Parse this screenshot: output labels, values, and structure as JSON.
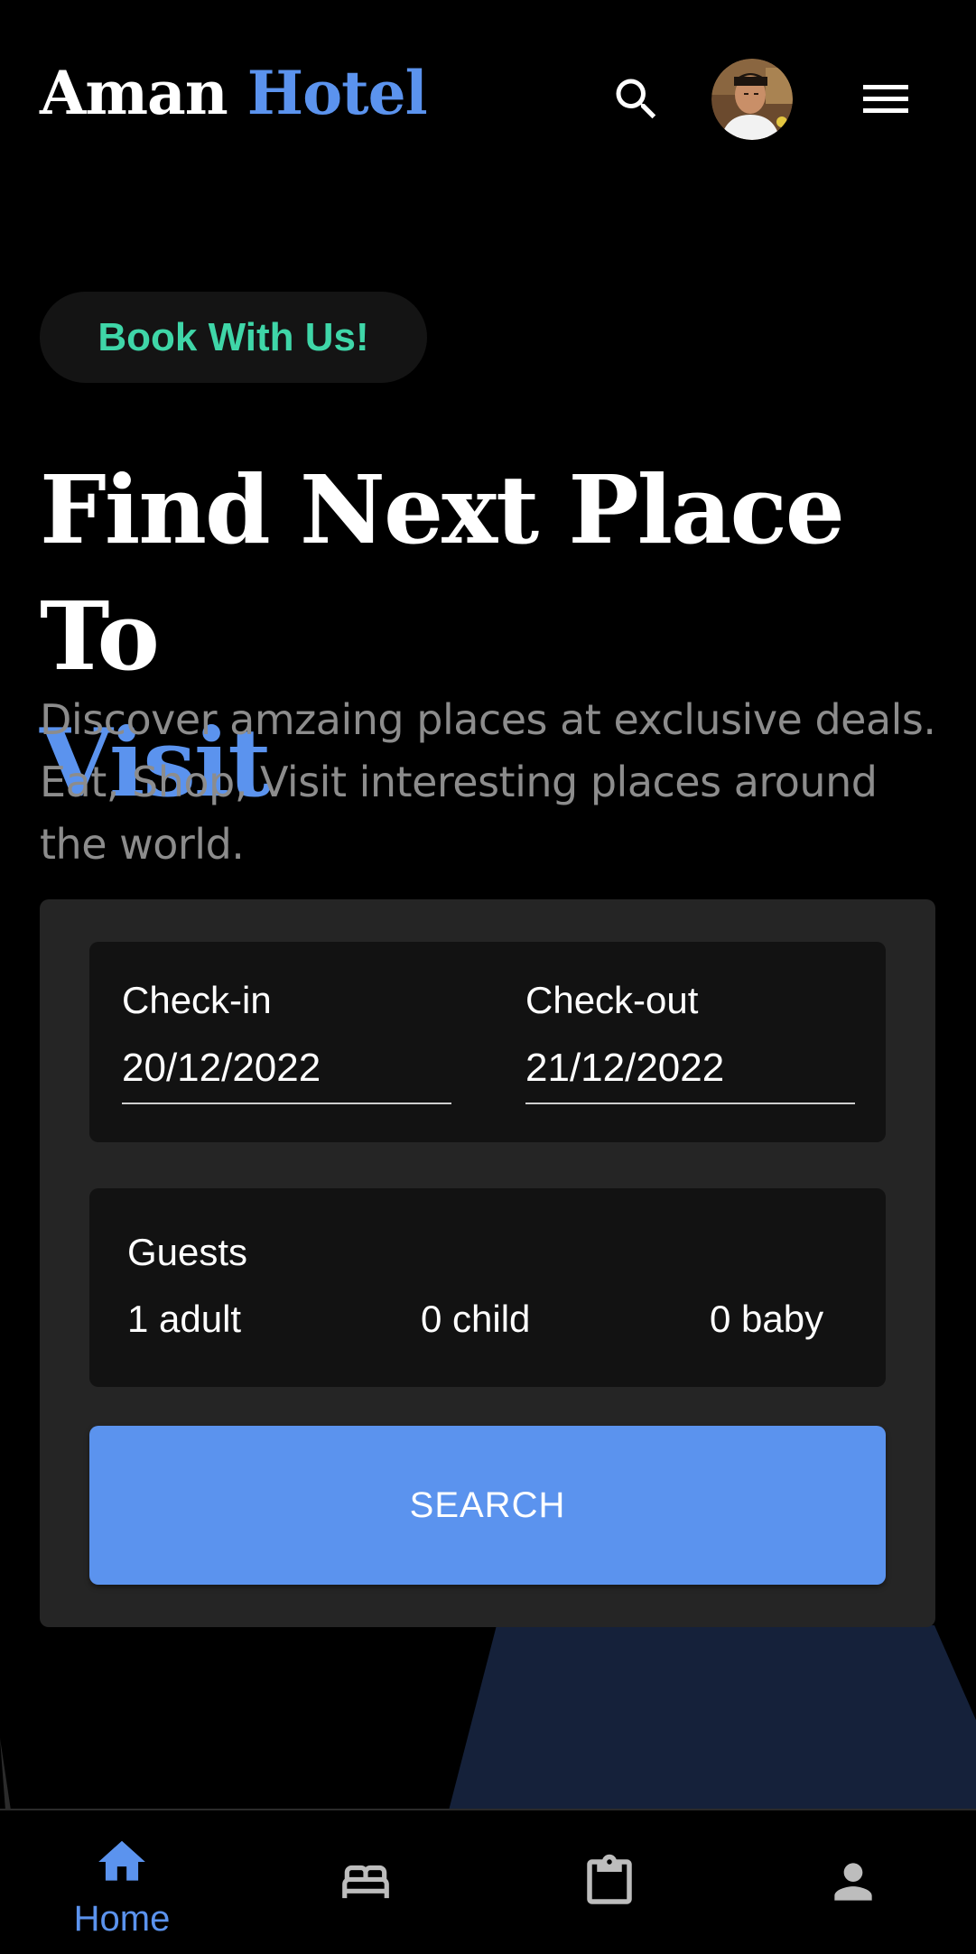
{
  "header": {
    "brand_primary": "Aman",
    "brand_accent": "Hotel"
  },
  "hero": {
    "badge": "Book With Us!",
    "title_line1": "Find Next Place To",
    "title_accent": "Visit",
    "description": "Discover amzaing places at exclusive deals. Eat, Shop, Visit interesting places around the world."
  },
  "booking": {
    "checkin_label": "Check-in",
    "checkin_value": "20/12/2022",
    "checkout_label": "Check-out",
    "checkout_value": "21/12/2022",
    "guests_label": "Guests",
    "adults": "1 adult",
    "children": "0 child",
    "babies": "0 baby",
    "search_label": "SEARCH"
  },
  "bottom_nav": {
    "items": [
      {
        "icon": "home-icon",
        "label": "Home",
        "active": true
      },
      {
        "icon": "bed-icon",
        "label": "",
        "active": false
      },
      {
        "icon": "clipboard-icon",
        "label": "",
        "active": false
      },
      {
        "icon": "person-icon",
        "label": "",
        "active": false
      }
    ]
  },
  "colors": {
    "background": "#000000",
    "accent": "#5b93ee",
    "badge_text": "#3fd6a8",
    "card": "#252525",
    "field": "#121212",
    "muted_text": "#8c8c8c",
    "inactive_icon": "#bdbdbd"
  }
}
